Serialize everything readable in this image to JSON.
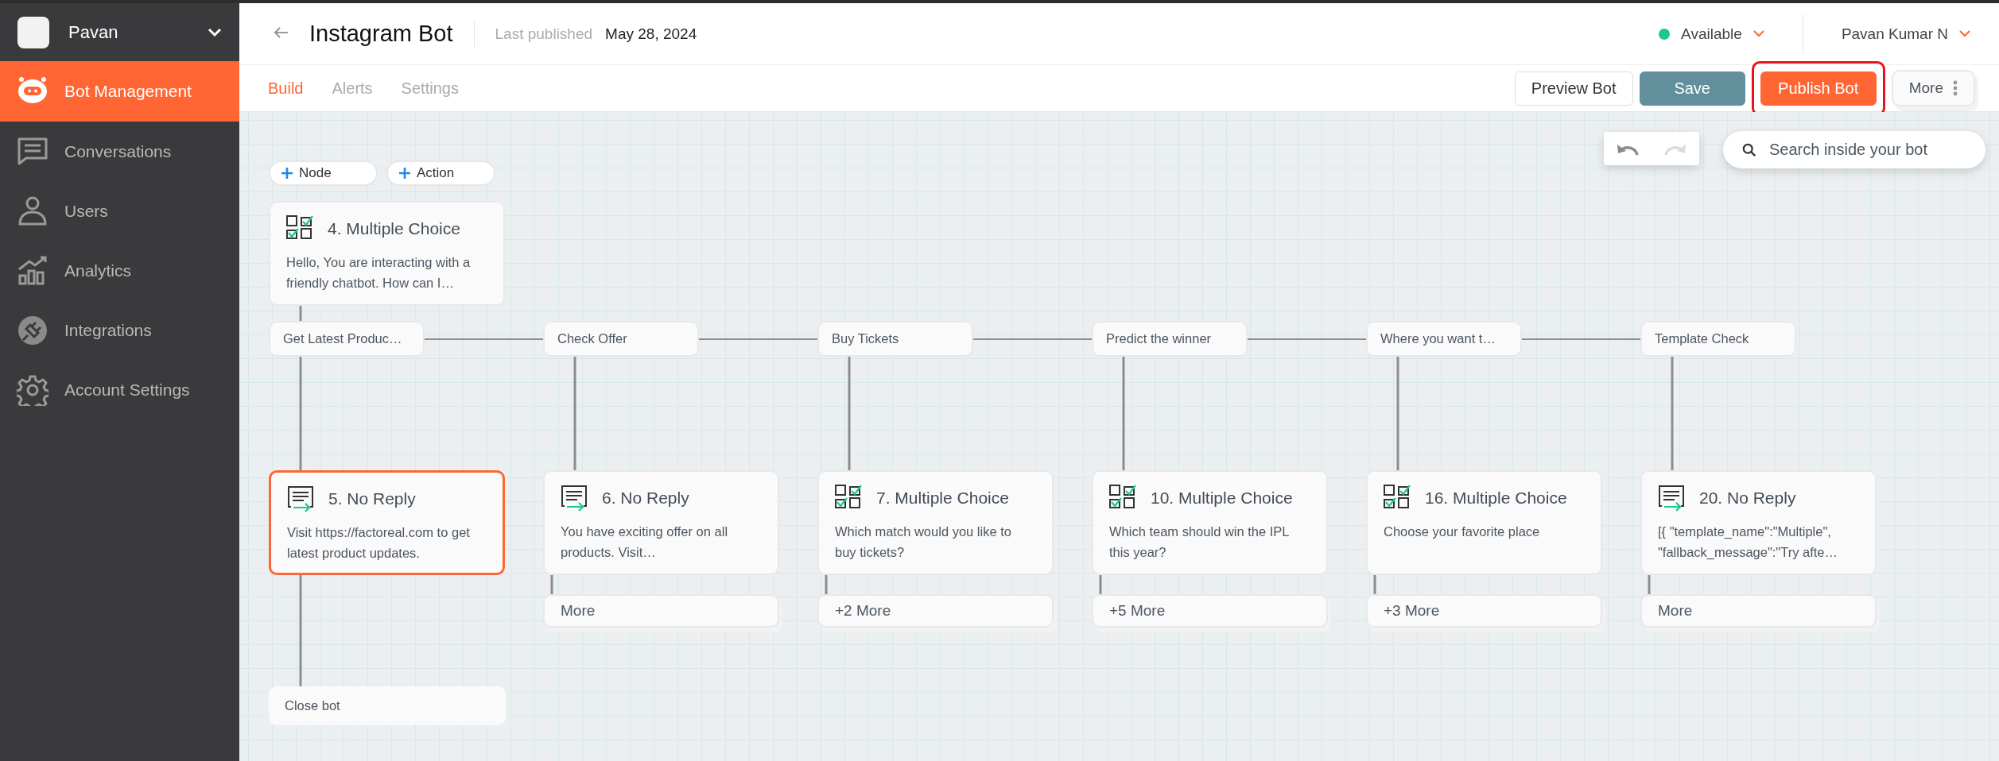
{
  "sidebar": {
    "workspace": "Pavan",
    "items": [
      {
        "label": "Bot Management",
        "selected": true
      },
      {
        "label": "Conversations",
        "selected": false
      },
      {
        "label": "Users",
        "selected": false
      },
      {
        "label": "Analytics",
        "selected": false
      },
      {
        "label": "Integrations",
        "selected": false
      },
      {
        "label": "Account Settings",
        "selected": false
      }
    ]
  },
  "header": {
    "title": "Instagram Bot",
    "published_label": "Last published",
    "published_date": "May 28, 2024",
    "status": "Available",
    "user": "Pavan Kumar N"
  },
  "tabs": [
    {
      "label": "Build",
      "selected": true
    },
    {
      "label": "Alerts",
      "selected": false
    },
    {
      "label": "Settings",
      "selected": false
    }
  ],
  "actions": [
    {
      "label": "Preview Bot",
      "kind": "outline",
      "highlighted": false
    },
    {
      "label": "Save",
      "kind": "secondary",
      "highlighted": false
    },
    {
      "label": "Publish Bot",
      "kind": "primary",
      "highlighted": true
    },
    {
      "label": "More",
      "kind": "more",
      "highlighted": false
    }
  ],
  "canvas": {
    "add_buttons": [
      "Node",
      "Action"
    ],
    "search_placeholder": "Search inside your bot",
    "root": {
      "title": "4. Multiple Choice",
      "kind": "multiple_choice",
      "text": "Hello, You are interacting with a friendly chatbot. How can I…"
    },
    "branches": [
      {
        "option": "Get Latest Produc…",
        "node": {
          "title": "5. No Reply",
          "kind": "no_reply",
          "selected": true,
          "text": "Visit https://factoreal.com to get latest product updates."
        },
        "next": "Close bot"
      },
      {
        "option": "Check Offer",
        "node": {
          "title": "6. No Reply",
          "kind": "no_reply",
          "selected": false,
          "text": "You have exciting offer on all products. Visit…"
        },
        "more": "More"
      },
      {
        "option": "Buy Tickets",
        "node": {
          "title": "7. Multiple Choice",
          "kind": "multiple_choice",
          "selected": false,
          "text": "Which match would you like to buy tickets?"
        },
        "more": "+2 More"
      },
      {
        "option": "Predict the winner",
        "node": {
          "title": "10. Multiple Choice",
          "kind": "multiple_choice",
          "selected": false,
          "text": "Which team should win the IPL this year?"
        },
        "more": "+5 More"
      },
      {
        "option": "Where you want t…",
        "node": {
          "title": "16. Multiple Choice",
          "kind": "multiple_choice",
          "selected": false,
          "text": "Choose your favorite place"
        },
        "more": "+3 More"
      },
      {
        "option": "Template Check",
        "node": {
          "title": "20. No Reply",
          "kind": "no_reply",
          "selected": false,
          "text": "[{ \"template_name\":\"Multiple\", \"fallback_message\":\"Try afte…"
        },
        "more": "More"
      }
    ]
  }
}
